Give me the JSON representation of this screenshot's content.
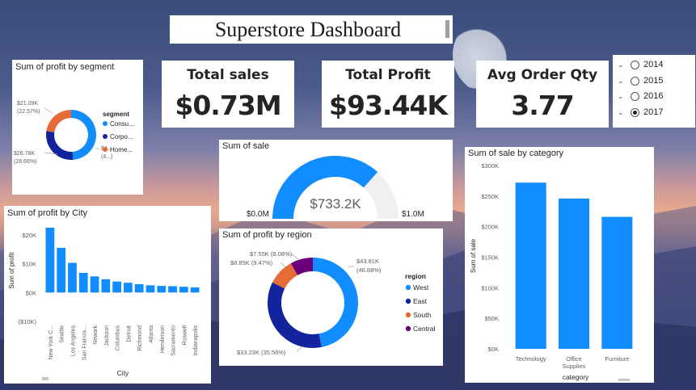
{
  "dashboard": {
    "title": "Superstore Dashboard"
  },
  "kpis": {
    "total_sales": {
      "label": "Total sales",
      "value": "$0.73M"
    },
    "total_profit": {
      "label": "Total Profit",
      "value": "$93.44K"
    },
    "avg_order_qty": {
      "label": "Avg Order Qty",
      "value": "3.77"
    }
  },
  "year_slicer": {
    "options": [
      "2014",
      "2015",
      "2016",
      "2017"
    ],
    "selected": "2017"
  },
  "colors": {
    "blue": "#118dff",
    "navy": "#12239e",
    "orange": "#e66c37",
    "purple": "#6b007b",
    "gauge_bg": "#f0f0f0"
  },
  "chart_data": [
    {
      "id": "segment",
      "type": "pie",
      "title": "Sum of profit by segment",
      "legend_title": "segment",
      "legend_placement": "right",
      "series": [
        {
          "name": "Consumer",
          "legend_label": "Consu...",
          "value": 45.58,
          "color": "#118dff",
          "label": "$4...",
          "label2": "(4...)"
        },
        {
          "name": "Corporate",
          "legend_label": "Corpo...",
          "value": 26.78,
          "color": "#12239e",
          "label": "$26.78K",
          "label2": "(28.66%)"
        },
        {
          "name": "Home Office",
          "legend_label": "Home...",
          "value": 21.09,
          "color": "#e66c37",
          "label": "$21.09K",
          "label2": "(22.57%)"
        }
      ]
    },
    {
      "id": "gauge",
      "type": "gauge",
      "title": "Sum of sale",
      "value": 733.2,
      "min": 0,
      "max": 1000,
      "value_label": "$733.2K",
      "min_label": "$0.0M",
      "max_label": "$1.0M"
    },
    {
      "id": "city",
      "type": "bar",
      "title": "Sum of profit by City",
      "xlabel": "City",
      "ylabel": "Sum of profit",
      "ylim": [
        -10,
        25
      ],
      "yticks": [
        {
          "v": 20,
          "label": "$20K"
        },
        {
          "v": 10,
          "label": "$10K"
        },
        {
          "v": 0,
          "label": "$0K"
        },
        {
          "v": -10,
          "label": "($10K)"
        }
      ],
      "categories": [
        "New York C...",
        "Seattle",
        "Los Angeles",
        "San Francis...",
        "Newark",
        "Jackson",
        "Columbus",
        "Detroit",
        "Richmond",
        "Atlanta",
        "Henderson",
        "Sacramento",
        "Roswell",
        "Indianapolis"
      ],
      "values": [
        22.5,
        15.5,
        10.3,
        6.8,
        5.6,
        4.6,
        3.8,
        3.4,
        2.9,
        2.5,
        2.3,
        2.2,
        2.0,
        1.8
      ]
    },
    {
      "id": "region",
      "type": "pie",
      "title": "Sum of profit by region",
      "legend_title": "region",
      "legend_placement": "right",
      "series": [
        {
          "name": "West",
          "value": 43.81,
          "color": "#118dff",
          "label": "$43.81K",
          "label2": "(46.88%)"
        },
        {
          "name": "East",
          "value": 33.23,
          "color": "#12239e",
          "label": "$33.23K (35.56%)"
        },
        {
          "name": "South",
          "value": 8.85,
          "color": "#e66c37",
          "label": "$8.85K (9.47%)"
        },
        {
          "name": "Central",
          "value": 7.55,
          "color": "#6b007b",
          "label": "$7.55K (8.08%)"
        }
      ]
    },
    {
      "id": "category",
      "type": "bar",
      "title": "Sum of sale by category",
      "xlabel": "category",
      "ylabel": "Sum of sale",
      "ylim": [
        0,
        300
      ],
      "yticks": [
        {
          "v": 300,
          "label": "$300K"
        },
        {
          "v": 250,
          "label": "$250K"
        },
        {
          "v": 200,
          "label": "$200K"
        },
        {
          "v": 150,
          "label": "$150K"
        },
        {
          "v": 100,
          "label": "$100K"
        },
        {
          "v": 50,
          "label": "$50K"
        },
        {
          "v": 0,
          "label": "$0K"
        }
      ],
      "categories": [
        "Technology",
        "Office Supplies",
        "Furniture"
      ],
      "category_lines": [
        [
          "Technology"
        ],
        [
          "Office",
          "Supplies"
        ],
        [
          "Furniture"
        ]
      ],
      "values": [
        272,
        246,
        216
      ]
    }
  ]
}
